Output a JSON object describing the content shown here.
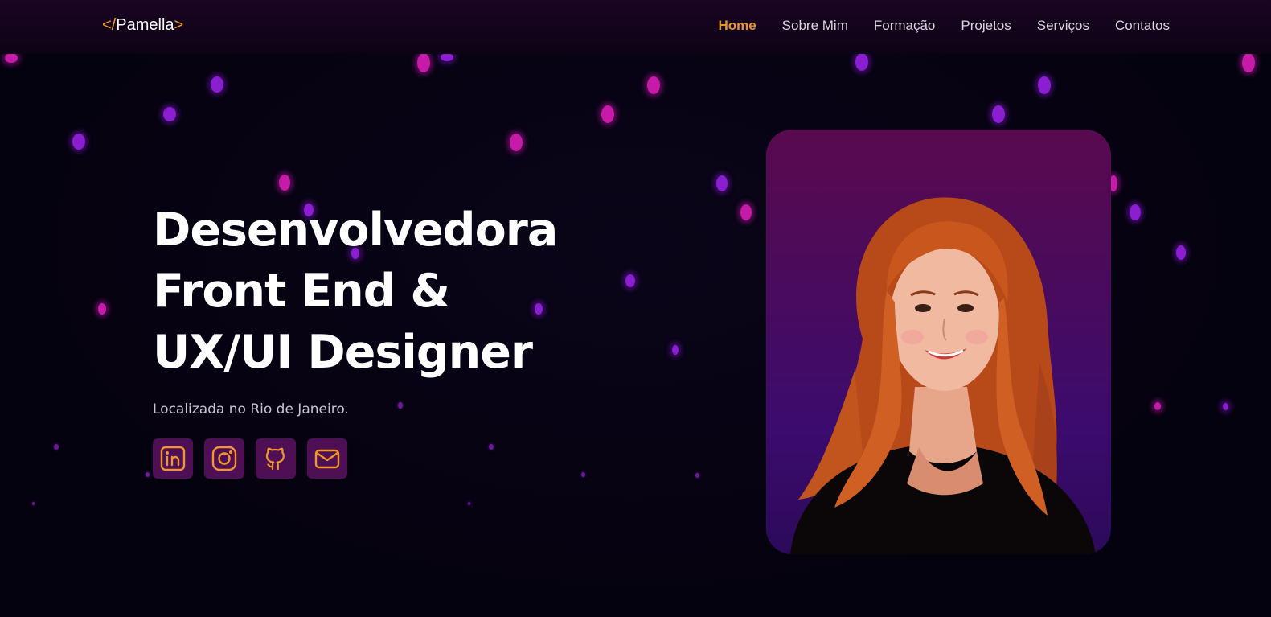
{
  "logo": {
    "open": "</",
    "name": "Pamella",
    "close": ">"
  },
  "nav": {
    "items": [
      {
        "label": "Home",
        "active": true
      },
      {
        "label": "Sobre Mim",
        "active": false
      },
      {
        "label": "Formação",
        "active": false
      },
      {
        "label": "Projetos",
        "active": false
      },
      {
        "label": "Serviços",
        "active": false
      },
      {
        "label": "Contatos",
        "active": false
      }
    ]
  },
  "hero": {
    "title_lines": [
      "Desenvolvedora",
      "Front End &",
      "UX/UI Designer"
    ],
    "location": "Localizada no Rio de Janeiro."
  },
  "socials": [
    {
      "icon": "linkedin-icon"
    },
    {
      "icon": "instagram-icon"
    },
    {
      "icon": "github-icon"
    },
    {
      "icon": "mail-icon"
    }
  ],
  "photo": {
    "subject": "portrait"
  },
  "colors": {
    "accent": "#e8922a",
    "icon_bg": "#4e0f55",
    "background": "#05020f",
    "card_top": "#5a0a4e",
    "card_bottom": "#2c0a5a"
  }
}
